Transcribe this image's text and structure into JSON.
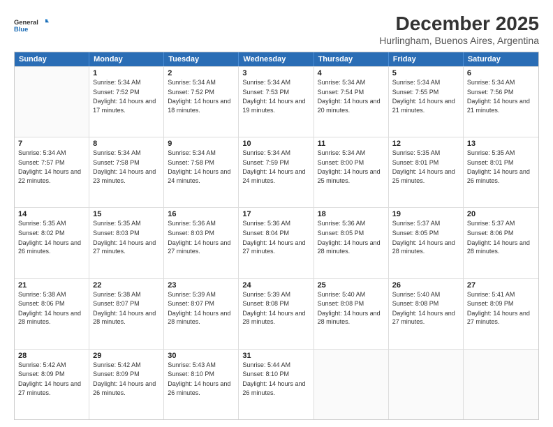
{
  "logo": {
    "line1": "General",
    "line2": "Blue"
  },
  "title": "December 2025",
  "subtitle": "Hurlingham, Buenos Aires, Argentina",
  "weekdays": [
    "Sunday",
    "Monday",
    "Tuesday",
    "Wednesday",
    "Thursday",
    "Friday",
    "Saturday"
  ],
  "rows": [
    [
      {
        "day": "",
        "sunrise": "",
        "sunset": "",
        "daylight": ""
      },
      {
        "day": "1",
        "sunrise": "Sunrise: 5:34 AM",
        "sunset": "Sunset: 7:52 PM",
        "daylight": "Daylight: 14 hours and 17 minutes."
      },
      {
        "day": "2",
        "sunrise": "Sunrise: 5:34 AM",
        "sunset": "Sunset: 7:52 PM",
        "daylight": "Daylight: 14 hours and 18 minutes."
      },
      {
        "day": "3",
        "sunrise": "Sunrise: 5:34 AM",
        "sunset": "Sunset: 7:53 PM",
        "daylight": "Daylight: 14 hours and 19 minutes."
      },
      {
        "day": "4",
        "sunrise": "Sunrise: 5:34 AM",
        "sunset": "Sunset: 7:54 PM",
        "daylight": "Daylight: 14 hours and 20 minutes."
      },
      {
        "day": "5",
        "sunrise": "Sunrise: 5:34 AM",
        "sunset": "Sunset: 7:55 PM",
        "daylight": "Daylight: 14 hours and 21 minutes."
      },
      {
        "day": "6",
        "sunrise": "Sunrise: 5:34 AM",
        "sunset": "Sunset: 7:56 PM",
        "daylight": "Daylight: 14 hours and 21 minutes."
      }
    ],
    [
      {
        "day": "7",
        "sunrise": "Sunrise: 5:34 AM",
        "sunset": "Sunset: 7:57 PM",
        "daylight": "Daylight: 14 hours and 22 minutes."
      },
      {
        "day": "8",
        "sunrise": "Sunrise: 5:34 AM",
        "sunset": "Sunset: 7:58 PM",
        "daylight": "Daylight: 14 hours and 23 minutes."
      },
      {
        "day": "9",
        "sunrise": "Sunrise: 5:34 AM",
        "sunset": "Sunset: 7:58 PM",
        "daylight": "Daylight: 14 hours and 24 minutes."
      },
      {
        "day": "10",
        "sunrise": "Sunrise: 5:34 AM",
        "sunset": "Sunset: 7:59 PM",
        "daylight": "Daylight: 14 hours and 24 minutes."
      },
      {
        "day": "11",
        "sunrise": "Sunrise: 5:34 AM",
        "sunset": "Sunset: 8:00 PM",
        "daylight": "Daylight: 14 hours and 25 minutes."
      },
      {
        "day": "12",
        "sunrise": "Sunrise: 5:35 AM",
        "sunset": "Sunset: 8:01 PM",
        "daylight": "Daylight: 14 hours and 25 minutes."
      },
      {
        "day": "13",
        "sunrise": "Sunrise: 5:35 AM",
        "sunset": "Sunset: 8:01 PM",
        "daylight": "Daylight: 14 hours and 26 minutes."
      }
    ],
    [
      {
        "day": "14",
        "sunrise": "Sunrise: 5:35 AM",
        "sunset": "Sunset: 8:02 PM",
        "daylight": "Daylight: 14 hours and 26 minutes."
      },
      {
        "day": "15",
        "sunrise": "Sunrise: 5:35 AM",
        "sunset": "Sunset: 8:03 PM",
        "daylight": "Daylight: 14 hours and 27 minutes."
      },
      {
        "day": "16",
        "sunrise": "Sunrise: 5:36 AM",
        "sunset": "Sunset: 8:03 PM",
        "daylight": "Daylight: 14 hours and 27 minutes."
      },
      {
        "day": "17",
        "sunrise": "Sunrise: 5:36 AM",
        "sunset": "Sunset: 8:04 PM",
        "daylight": "Daylight: 14 hours and 27 minutes."
      },
      {
        "day": "18",
        "sunrise": "Sunrise: 5:36 AM",
        "sunset": "Sunset: 8:05 PM",
        "daylight": "Daylight: 14 hours and 28 minutes."
      },
      {
        "day": "19",
        "sunrise": "Sunrise: 5:37 AM",
        "sunset": "Sunset: 8:05 PM",
        "daylight": "Daylight: 14 hours and 28 minutes."
      },
      {
        "day": "20",
        "sunrise": "Sunrise: 5:37 AM",
        "sunset": "Sunset: 8:06 PM",
        "daylight": "Daylight: 14 hours and 28 minutes."
      }
    ],
    [
      {
        "day": "21",
        "sunrise": "Sunrise: 5:38 AM",
        "sunset": "Sunset: 8:06 PM",
        "daylight": "Daylight: 14 hours and 28 minutes."
      },
      {
        "day": "22",
        "sunrise": "Sunrise: 5:38 AM",
        "sunset": "Sunset: 8:07 PM",
        "daylight": "Daylight: 14 hours and 28 minutes."
      },
      {
        "day": "23",
        "sunrise": "Sunrise: 5:39 AM",
        "sunset": "Sunset: 8:07 PM",
        "daylight": "Daylight: 14 hours and 28 minutes."
      },
      {
        "day": "24",
        "sunrise": "Sunrise: 5:39 AM",
        "sunset": "Sunset: 8:08 PM",
        "daylight": "Daylight: 14 hours and 28 minutes."
      },
      {
        "day": "25",
        "sunrise": "Sunrise: 5:40 AM",
        "sunset": "Sunset: 8:08 PM",
        "daylight": "Daylight: 14 hours and 28 minutes."
      },
      {
        "day": "26",
        "sunrise": "Sunrise: 5:40 AM",
        "sunset": "Sunset: 8:08 PM",
        "daylight": "Daylight: 14 hours and 27 minutes."
      },
      {
        "day": "27",
        "sunrise": "Sunrise: 5:41 AM",
        "sunset": "Sunset: 8:09 PM",
        "daylight": "Daylight: 14 hours and 27 minutes."
      }
    ],
    [
      {
        "day": "28",
        "sunrise": "Sunrise: 5:42 AM",
        "sunset": "Sunset: 8:09 PM",
        "daylight": "Daylight: 14 hours and 27 minutes."
      },
      {
        "day": "29",
        "sunrise": "Sunrise: 5:42 AM",
        "sunset": "Sunset: 8:09 PM",
        "daylight": "Daylight: 14 hours and 26 minutes."
      },
      {
        "day": "30",
        "sunrise": "Sunrise: 5:43 AM",
        "sunset": "Sunset: 8:10 PM",
        "daylight": "Daylight: 14 hours and 26 minutes."
      },
      {
        "day": "31",
        "sunrise": "Sunrise: 5:44 AM",
        "sunset": "Sunset: 8:10 PM",
        "daylight": "Daylight: 14 hours and 26 minutes."
      },
      {
        "day": "",
        "sunrise": "",
        "sunset": "",
        "daylight": ""
      },
      {
        "day": "",
        "sunrise": "",
        "sunset": "",
        "daylight": ""
      },
      {
        "day": "",
        "sunrise": "",
        "sunset": "",
        "daylight": ""
      }
    ]
  ]
}
